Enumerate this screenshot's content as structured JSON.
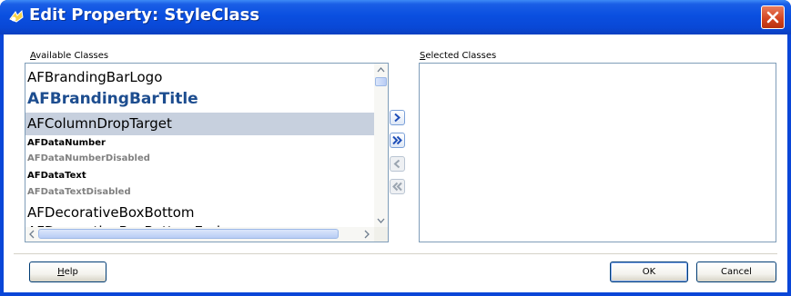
{
  "window": {
    "title": "Edit Property: StyleClass"
  },
  "available": {
    "label_mnemonic": "A",
    "label_rest": "vailable Classes",
    "items": [
      {
        "text": "AFBrandingBarLogo"
      },
      {
        "text": "AFBrandingBarTitle"
      },
      {
        "text": "AFColumnDropTarget"
      },
      {
        "text": "AFDataNumber"
      },
      {
        "text": "AFDataNumberDisabled"
      },
      {
        "text": "AFDataText"
      },
      {
        "text": "AFDataTextDisabled"
      },
      {
        "text": "AFDecorativeBoxBottom"
      },
      {
        "text": "AFDecorativeBoxBottomEnd"
      }
    ],
    "selected_item": "AFColumnDropTarget"
  },
  "selected": {
    "label_mnemonic": "S",
    "label_rest": "elected Classes",
    "items": []
  },
  "move_buttons": [
    {
      "icon": "move-right-icon",
      "enabled": true
    },
    {
      "icon": "move-all-right-icon",
      "enabled": true
    },
    {
      "icon": "move-left-icon",
      "enabled": false
    },
    {
      "icon": "move-all-left-icon",
      "enabled": false
    }
  ],
  "buttons": {
    "help_mnemonic": "H",
    "help_rest": "elp",
    "ok": "OK",
    "cancel": "Cancel"
  },
  "colors": {
    "titlebar": "#0a4fe0",
    "selection": "#c7d0de",
    "title_item": "#1d4d8f",
    "disabled_text": "#808080"
  }
}
